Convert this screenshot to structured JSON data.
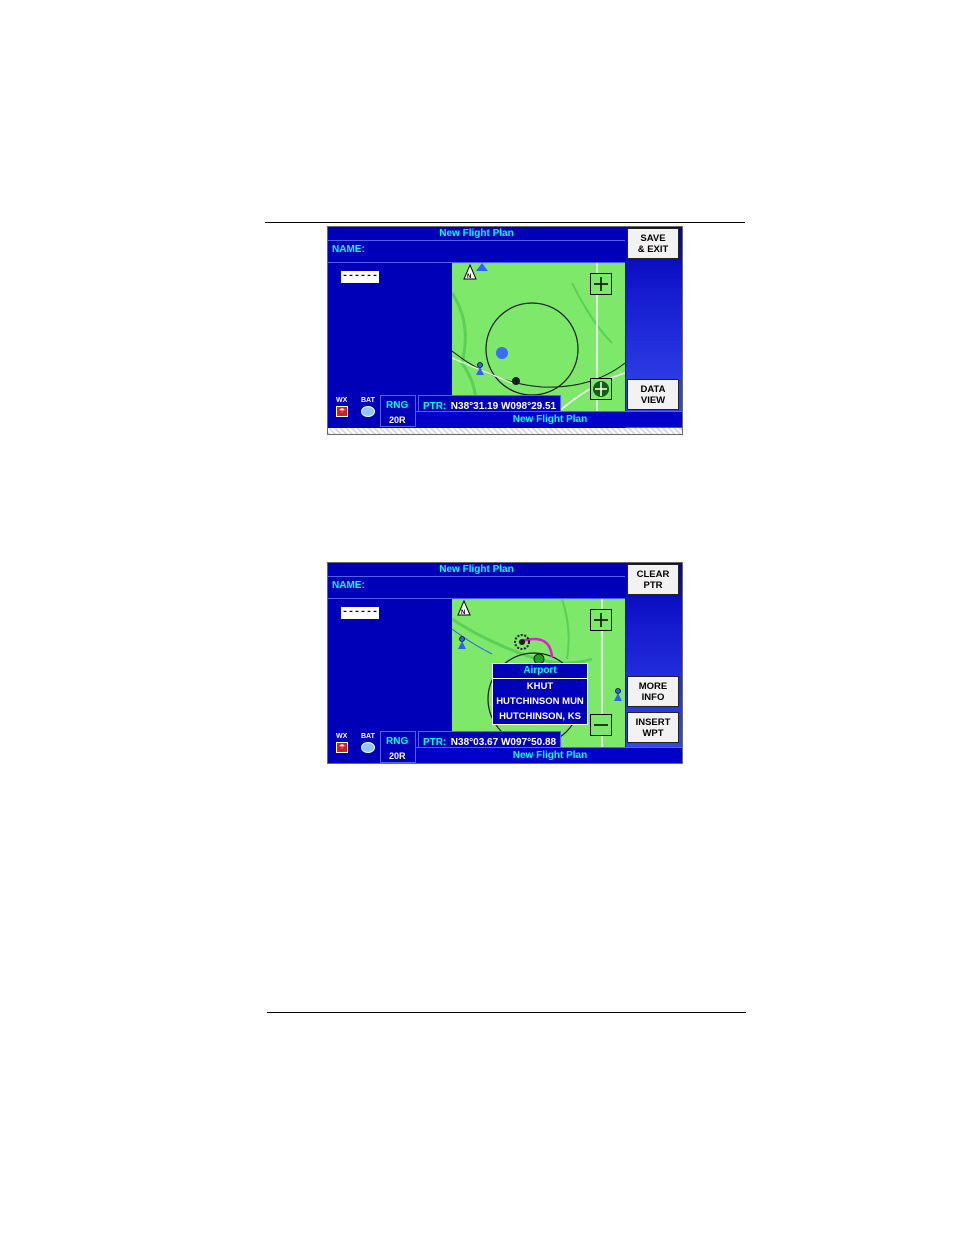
{
  "screens": [
    {
      "title": "New Flight Plan",
      "name_label": "NAME:",
      "entry": "------",
      "softkeys": {
        "top": [
          "SAVE",
          "& EXIT"
        ],
        "bottom": [
          "DATA",
          "VIEW"
        ]
      },
      "status": {
        "wx_label": "WX",
        "bat_label": "BAT",
        "rng_label": "RNG",
        "rng_value": "20R",
        "ptr_label": "PTR:",
        "ptr_value": "N38°31.19 W098°29.51",
        "plan_name": "New Flight Plan"
      }
    },
    {
      "title": "New Flight Plan",
      "name_label": "NAME:",
      "entry": "------",
      "softkeys": {
        "top": [
          "CLEAR",
          "PTR"
        ],
        "middle": [
          "MORE",
          "INFO"
        ],
        "bottom": [
          "INSERT",
          "WPT"
        ]
      },
      "popup": {
        "title": "Airport",
        "id": "KHUT",
        "name": "HUTCHINSON MUN",
        "city": "HUTCHINSON, KS"
      },
      "status": {
        "wx_label": "WX",
        "bat_label": "BAT",
        "rng_label": "RNG",
        "rng_value": "20R",
        "ptr_label": "PTR:",
        "ptr_value": "N38°03.67 W097°50.88",
        "plan_name": "New Flight Plan"
      }
    }
  ],
  "colors": {
    "screen_bg": "#0000b8",
    "map_green": "#7ee86a",
    "cyan_text": "#00ffff",
    "route_magenta": "#e020d0"
  }
}
